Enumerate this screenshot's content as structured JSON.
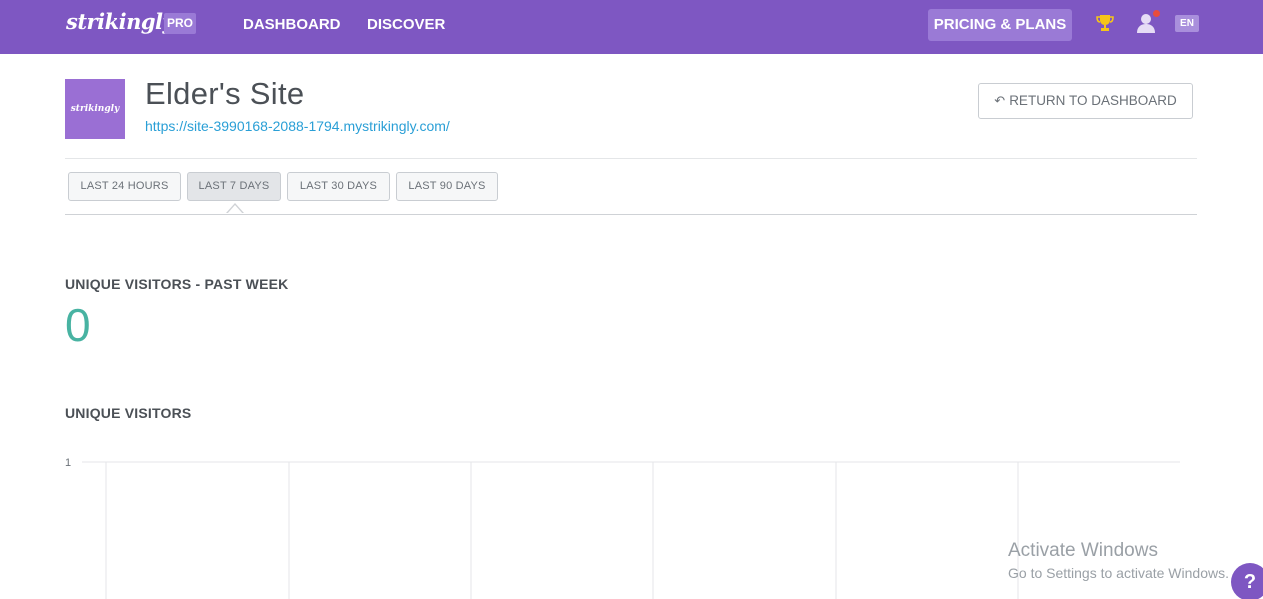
{
  "topbar": {
    "logo": "strikingly",
    "badge": "PRO",
    "nav": [
      {
        "label": "DASHBOARD"
      },
      {
        "label": "DISCOVER"
      }
    ],
    "pricing_label": "PRICING & PLANS",
    "lang": "EN",
    "colors": {
      "bar": "#7e57c2",
      "badge": "#9a7ad6",
      "trophy": "#f5c518",
      "notification": "#e74c3c"
    }
  },
  "site": {
    "thumb_text": "strikingly",
    "title": "Elder's Site",
    "url": "https://site-3990168-2088-1794.mystrikingly.com/",
    "return_label": "RETURN TO DASHBOARD"
  },
  "tabs": [
    {
      "label": "LAST 24 HOURS",
      "active": false
    },
    {
      "label": "LAST 7 DAYS",
      "active": true
    },
    {
      "label": "LAST 30 DAYS",
      "active": false
    },
    {
      "label": "LAST 90 DAYS",
      "active": false
    }
  ],
  "stats": {
    "unique_label": "UNIQUE VISITORS - PAST WEEK",
    "unique_value": "0",
    "chart_label": "UNIQUE VISITORS",
    "value_color": "#48b3a2"
  },
  "chart_data": {
    "type": "line",
    "title": "",
    "y_ticks": [
      "1"
    ],
    "ylim": [
      0,
      1
    ],
    "grid": true
  },
  "overlay": {
    "activate_title": "Activate Windows",
    "activate_sub": "Go to Settings to activate Windows.",
    "help": "?"
  }
}
